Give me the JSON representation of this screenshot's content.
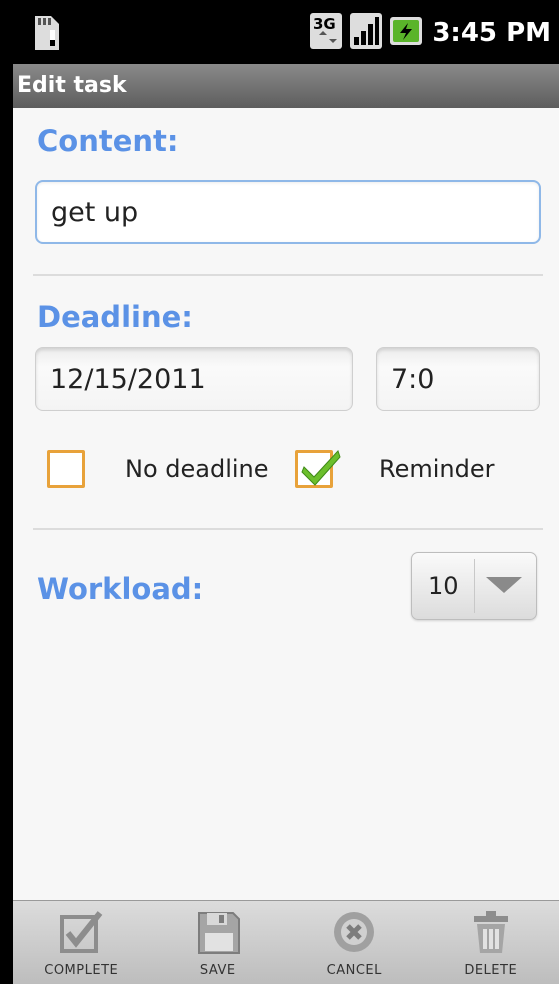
{
  "status_bar": {
    "time": "3:45 PM",
    "icons": [
      "sd-card-icon",
      "3g-icon",
      "signal-icon",
      "battery-icon"
    ]
  },
  "title_bar": {
    "title": "Edit task"
  },
  "content": {
    "label": "Content:",
    "value": "get up"
  },
  "deadline": {
    "label": "Deadline:",
    "date": "12/15/2011",
    "time": "7:0",
    "no_deadline": {
      "label": "No deadline",
      "checked": false
    },
    "reminder": {
      "label": "Reminder",
      "checked": true
    }
  },
  "workload": {
    "label": "Workload:",
    "selected": "10"
  },
  "bottom_bar": {
    "complete": "COMPLETE",
    "save": "SAVE",
    "cancel": "CANCEL",
    "delete": "DELETE"
  },
  "colors": {
    "label_blue": "#5b92e6",
    "checkbox_orange": "#e8a23a",
    "check_green": "#6cbf2c"
  }
}
